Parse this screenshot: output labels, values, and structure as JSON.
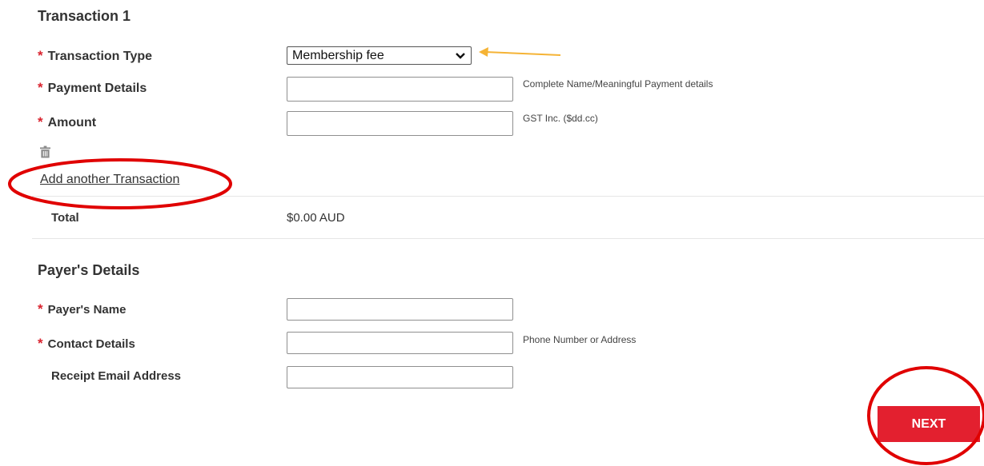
{
  "transaction": {
    "title": "Transaction 1",
    "type_label": "Transaction Type",
    "type_value": "Membership fee",
    "payment_label": "Payment Details",
    "payment_value": "",
    "payment_hint": "Complete Name/Meaningful Payment details",
    "amount_label": "Amount",
    "amount_value": "",
    "amount_hint": "GST Inc. ($dd.cc)",
    "add_link": "Add another Transaction",
    "required_mark": "*"
  },
  "total": {
    "label": "Total",
    "value": "$0.00 AUD"
  },
  "payer": {
    "title": "Payer's Details",
    "name_label": "Payer's Name",
    "name_value": "",
    "contact_label": "Contact Details",
    "contact_value": "",
    "contact_hint": "Phone Number or Address",
    "email_label": "Receipt Email Address",
    "email_value": ""
  },
  "actions": {
    "next_label": "NEXT"
  },
  "colors": {
    "accent_red": "#e3202f",
    "annotation_red": "#e00000",
    "annotation_arrow": "#f5b335"
  },
  "icons": {
    "delete": "trash-icon",
    "dropdown": "chevron-down-icon"
  }
}
